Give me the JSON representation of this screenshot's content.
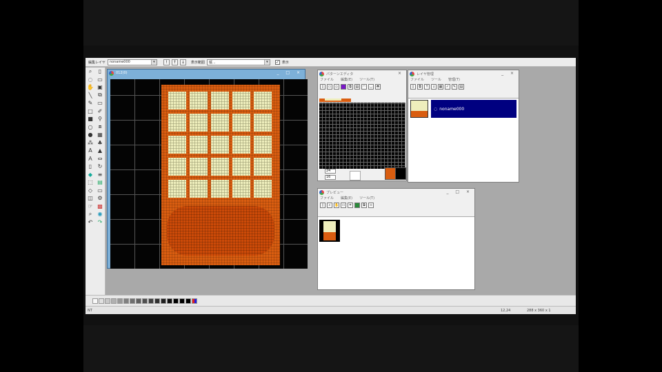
{
  "toolbar": {
    "layer_label": "編集レイヤ",
    "layer_value": "noname000",
    "display_mode_label": "表示範囲",
    "display_mode_value": "縦...",
    "show_label": "表示",
    "show_checked": "✓",
    "btn_a": "!",
    "btn_b": "↑",
    "btn_c": "↓"
  },
  "canvas_window": {
    "title": "012(0)"
  },
  "editor_window": {
    "title": "パターンエディタ",
    "menu": [
      "ファイル",
      "編集(E)",
      "ツール(T)"
    ]
  },
  "layer_window": {
    "title": "レイヤ管理",
    "menu": [
      "ファイル",
      "ツール",
      "管理(T)"
    ],
    "layer_name": "noname000"
  },
  "preview_window": {
    "title": "プレビュー",
    "menu": [
      "ファイル",
      "編集(E)",
      "ツール(T)"
    ]
  },
  "status": {
    "left": "NT",
    "mid": "12,24",
    "right": "288 x 360 x 1"
  },
  "window_controls": "_ □ ×",
  "colors": {
    "orange": "#d95d10",
    "cream": "#eeeebc",
    "canvas": "#040404",
    "selection": "#000080"
  }
}
